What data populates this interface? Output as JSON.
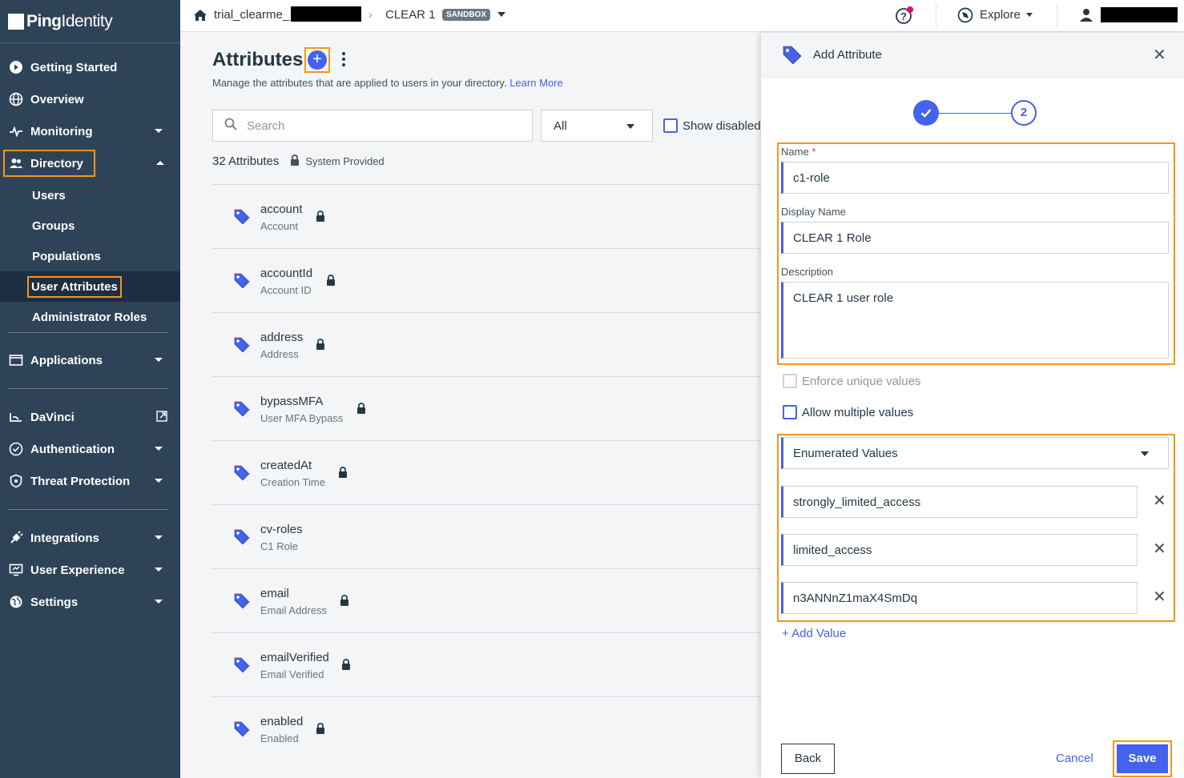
{
  "brand": {
    "logo_bold": "Ping",
    "logo_light": "Identity"
  },
  "topbar": {
    "env_name": "trial_clearme_",
    "app_name": "CLEAR 1",
    "badge": "SANDBOX",
    "explore_label": "Explore"
  },
  "sidebar": {
    "items": [
      {
        "label": "Getting Started",
        "icon": "play-circle-icon"
      },
      {
        "label": "Overview",
        "icon": "globe-icon"
      },
      {
        "label": "Monitoring",
        "icon": "pulse-icon"
      },
      {
        "label": "Directory",
        "icon": "users-icon"
      },
      {
        "label": "Applications",
        "icon": "window-icon"
      },
      {
        "label": "DaVinci",
        "icon": "davinci-icon"
      },
      {
        "label": "Authentication",
        "icon": "check-circle-icon"
      },
      {
        "label": "Threat Protection",
        "icon": "shield-icon"
      },
      {
        "label": "Integrations",
        "icon": "plug-icon"
      },
      {
        "label": "User Experience",
        "icon": "monitor-icon"
      },
      {
        "label": "Settings",
        "icon": "globe-icon"
      }
    ],
    "directory_sub": [
      "Users",
      "Groups",
      "Populations",
      "User Attributes",
      "Administrator Roles"
    ]
  },
  "main": {
    "title": "Attributes",
    "subtitle": "Manage the attributes that are applied to users in your directory.",
    "learn_more": "Learn More",
    "search_placeholder": "Search",
    "filter_value": "All",
    "show_disabled": "Show disabled",
    "count": "32 Attributes",
    "system_provided": "System Provided",
    "attributes": [
      {
        "name": "account",
        "display": "Account",
        "locked": true
      },
      {
        "name": "accountId",
        "display": "Account ID",
        "locked": true
      },
      {
        "name": "address",
        "display": "Address",
        "locked": true
      },
      {
        "name": "bypassMFA",
        "display": "User MFA Bypass",
        "locked": true
      },
      {
        "name": "createdAt",
        "display": "Creation Time",
        "locked": true
      },
      {
        "name": "cv-roles",
        "display": "C1 Role",
        "locked": false
      },
      {
        "name": "email",
        "display": "Email Address",
        "locked": true
      },
      {
        "name": "emailVerified",
        "display": "Email Verified",
        "locked": true
      },
      {
        "name": "enabled",
        "display": "Enabled",
        "locked": true
      }
    ]
  },
  "panel": {
    "title": "Add Attribute",
    "step2": "2",
    "name_label": "Name",
    "required_mark": "*",
    "name_value": "c1-role",
    "display_label": "Display Name",
    "display_value": "CLEAR 1 Role",
    "desc_label": "Description",
    "desc_value": "CLEAR 1 user role",
    "enforce_unique": "Enforce unique values",
    "allow_multiple": "Allow multiple values",
    "enum_type": "Enumerated Values",
    "values": [
      "strongly_limited_access",
      "limited_access",
      "n3ANNnZ1maX4SmDq"
    ],
    "add_value": "+ Add Value",
    "back": "Back",
    "cancel": "Cancel",
    "save": "Save"
  },
  "colors": {
    "accent": "#4462ed",
    "sidebar": "#2e4358",
    "highlight": "#f7941d"
  }
}
